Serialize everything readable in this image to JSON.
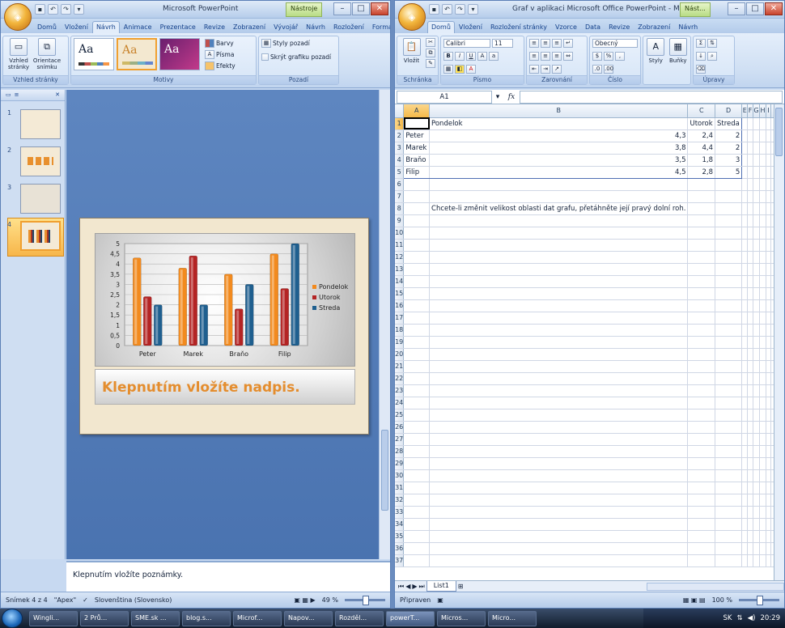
{
  "ppt": {
    "title": "Microsoft PowerPoint",
    "context_tab": "Nástroje",
    "tabs": [
      "Domů",
      "Vložení",
      "Návrh",
      "Animace",
      "Prezentace",
      "Revize",
      "Zobrazení",
      "Vývojář",
      "Návrh",
      "Rozložení",
      "Formát"
    ],
    "active_tab": 2,
    "ribbon": {
      "page_setup": "Vzhled stránky",
      "orientation": "Orientace snímku",
      "group_page": "Vzhled stránky",
      "group_themes": "Motivy",
      "colors": "Barvy",
      "fonts": "Písma",
      "effects": "Efekty",
      "bg_styles": "Styly pozadí",
      "hide_bg": "Skrýt grafiku pozadí",
      "group_bg": "Pozadí"
    },
    "slides": [
      "1",
      "2",
      "3",
      "4"
    ],
    "slide_title": "Klepnutím vložíte nadpis.",
    "notes": "Klepnutím vložíte poznámky.",
    "status": {
      "slide": "Snímek 4 z 4",
      "theme": "\"Apex\"",
      "language": "Slovenština (Slovensko)",
      "zoom": "49 %"
    }
  },
  "xl": {
    "title": "Graf v aplikaci Microsoft Office PowerPoint - Mi",
    "context_tab": "Nást...",
    "tabs": [
      "Domů",
      "Vložení",
      "Rozložení stránky",
      "Vzorce",
      "Data",
      "Revize",
      "Zobrazení",
      "Návrh"
    ],
    "active_tab": 0,
    "ribbon": {
      "paste": "Vložit",
      "font_name": "Calibri",
      "font_size": "11",
      "number_format": "Obecný",
      "styles": "Styly",
      "cells": "Buňky",
      "group_clipboard": "Schránka",
      "group_font": "Písmo",
      "group_align": "Zarovnání",
      "group_number": "Číslo",
      "group_edit": "Úpravy"
    },
    "namebox": "A1",
    "fx": "fx",
    "columns": [
      "A",
      "B",
      "C",
      "D",
      "E",
      "F",
      "G",
      "H",
      "I"
    ],
    "header_row": [
      "",
      "Pondelok",
      "Utorok",
      "Streda"
    ],
    "rows": [
      [
        "Peter",
        "4,3",
        "2,4",
        "2"
      ],
      [
        "Marek",
        "3,8",
        "4,4",
        "2"
      ],
      [
        "Braňo",
        "3,5",
        "1,8",
        "3"
      ],
      [
        "Filip",
        "4,5",
        "2,8",
        "5"
      ]
    ],
    "note_row": 8,
    "note": "Chcete-li změnit velikost oblasti dat grafu, přetáhněte její pravý dolní roh.",
    "sheet_tab": "List1",
    "status": {
      "ready": "Připraven",
      "zoom": "100 %"
    }
  },
  "chart_data": {
    "type": "bar",
    "categories": [
      "Peter",
      "Marek",
      "Braňo",
      "Filip"
    ],
    "series": [
      {
        "name": "Pondelok",
        "values": [
          4.3,
          3.8,
          3.5,
          4.5
        ]
      },
      {
        "name": "Utorok",
        "values": [
          2.4,
          4.4,
          1.8,
          2.8
        ]
      },
      {
        "name": "Streda",
        "values": [
          2,
          2,
          3,
          5
        ]
      }
    ],
    "ylim": [
      0,
      5
    ],
    "ytick_labels": [
      "0",
      "0,5",
      "1",
      "1,5",
      "2",
      "2,5",
      "3",
      "3,5",
      "4",
      "4,5",
      "5"
    ],
    "legend": "right",
    "grid": true,
    "colors": [
      "#f28a1e",
      "#b42424",
      "#1f5f8f"
    ]
  },
  "taskbar": {
    "tasks": [
      "Wingli...",
      "2 Prů...",
      "SME.sk ...",
      "blog.s...",
      "Microf...",
      "Napov...",
      "Rozděl...",
      "powerT...",
      "Micros...",
      "Micro..."
    ],
    "lang": "SK",
    "time": "20:29"
  }
}
